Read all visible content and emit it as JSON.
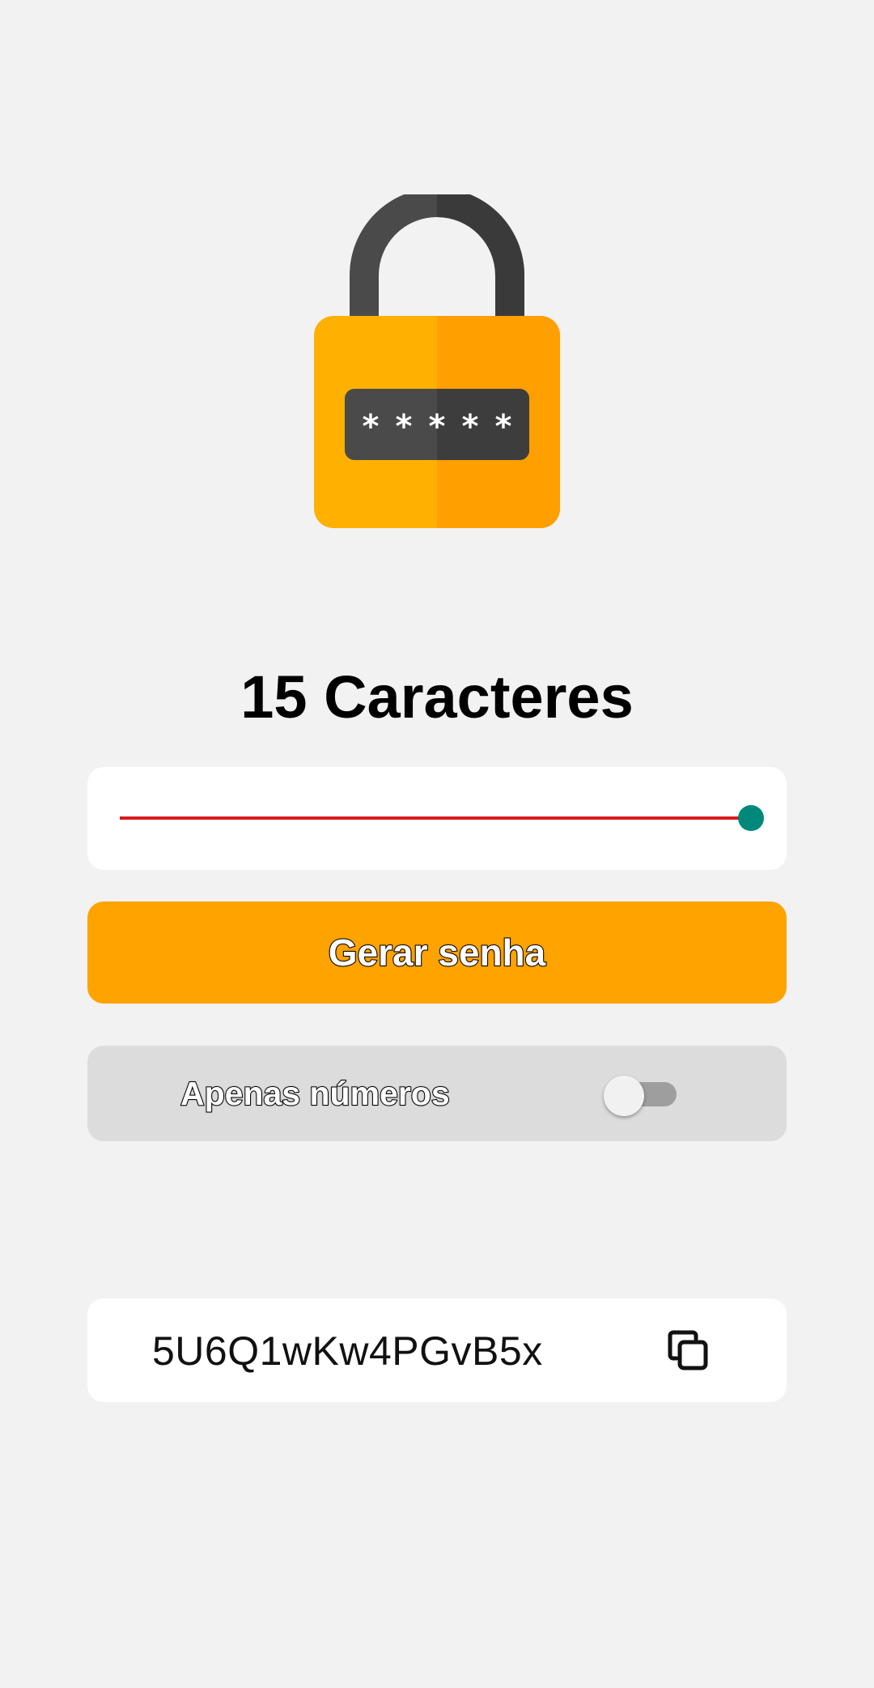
{
  "header": {
    "length_title": "15 Caracteres"
  },
  "slider": {
    "value": 15,
    "min": 0,
    "max": 15,
    "track_color": "#d81b1b",
    "thumb_color": "#00897b"
  },
  "actions": {
    "generate_label": "Gerar senha",
    "generate_color": "#ffa300"
  },
  "options": {
    "numbers_only_label": "Apenas números",
    "numbers_only_enabled": false
  },
  "result": {
    "password": "5U6Q1wKw4PGvB5x",
    "copy_icon": "copy-icon"
  },
  "icons": {
    "lock": "padlock-icon",
    "mask": "*****"
  },
  "colors": {
    "background": "#f2f2f2",
    "lock_body": "#ffb000",
    "lock_shackle": "#424242"
  }
}
